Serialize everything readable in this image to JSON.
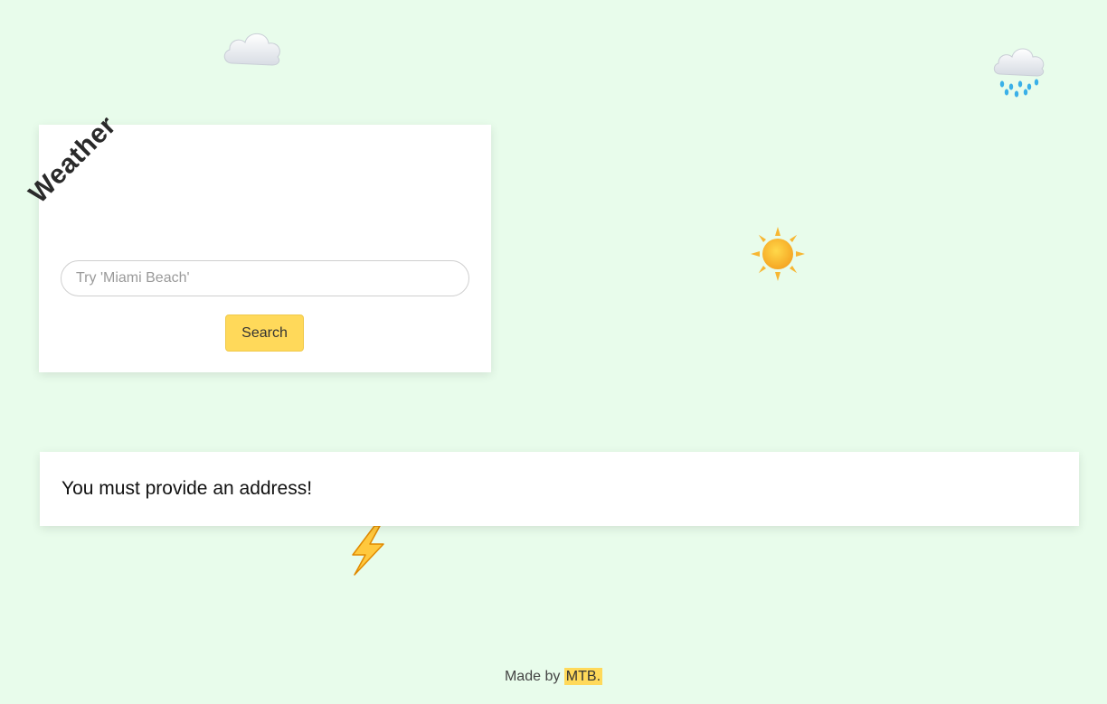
{
  "header": {
    "title": "Weather"
  },
  "search": {
    "placeholder": "Try 'Miami Beach'",
    "button_label": "Search"
  },
  "message": {
    "text": "You must provide an address!"
  },
  "footer": {
    "made_by": "Made by",
    "author": "MTB."
  },
  "decorations": [
    {
      "icon": "cloud-icon"
    },
    {
      "icon": "rain-cloud-icon"
    },
    {
      "icon": "sun-icon"
    },
    {
      "icon": "lightning-icon"
    }
  ],
  "colors": {
    "background": "#e8fceb",
    "accent": "#ffd95a",
    "card": "#ffffff"
  }
}
